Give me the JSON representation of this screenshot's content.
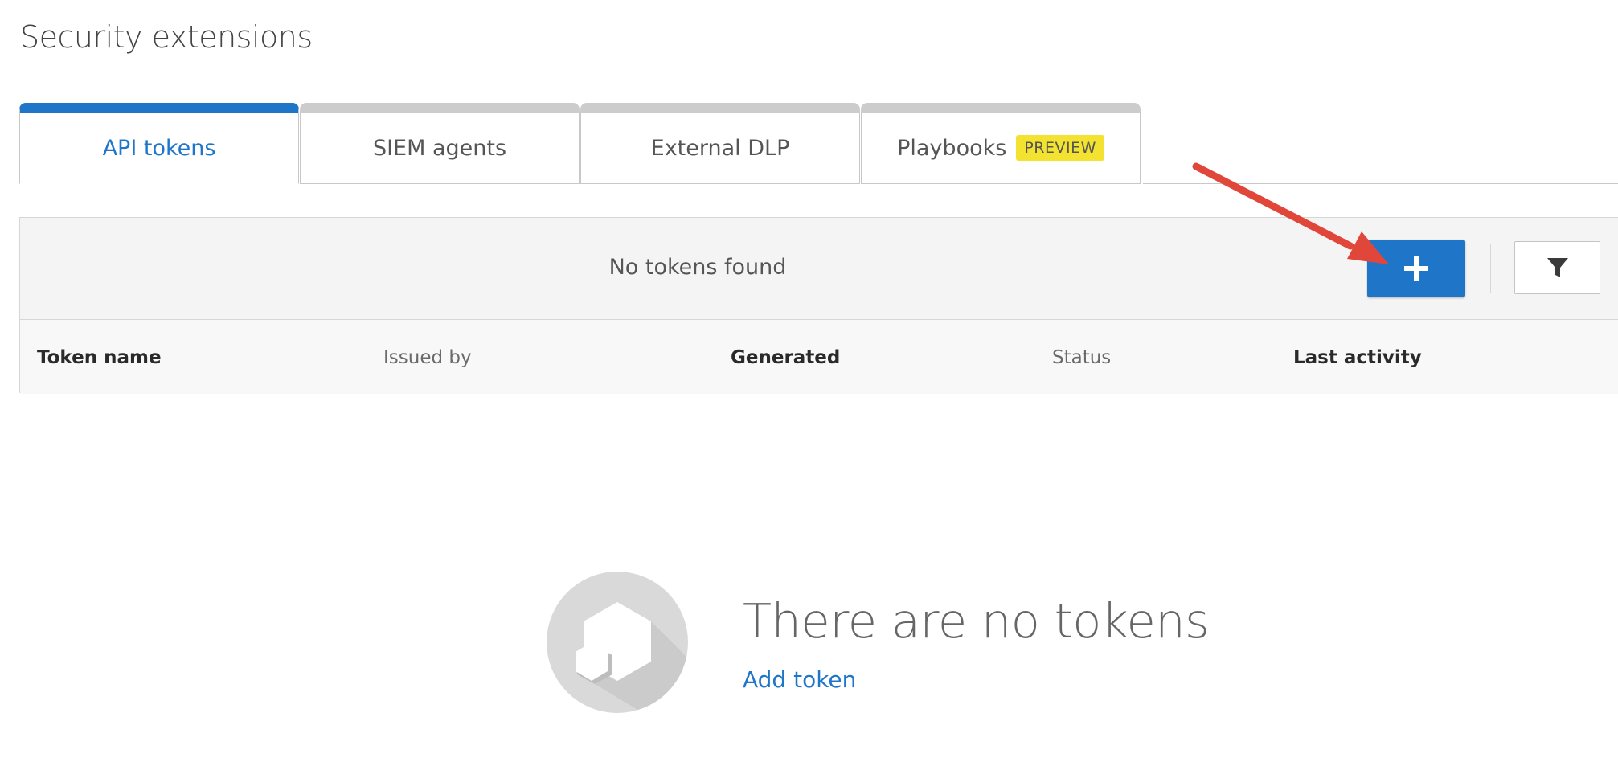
{
  "page": {
    "title": "Security extensions"
  },
  "tabs": [
    {
      "label": "API tokens",
      "active": true
    },
    {
      "label": "SIEM agents",
      "active": false
    },
    {
      "label": "External DLP",
      "active": false
    },
    {
      "label": "Playbooks",
      "active": false,
      "badge": "PREVIEW"
    }
  ],
  "toolbar": {
    "status_text": "No tokens found",
    "add_button_icon": "plus-icon",
    "filter_button_icon": "filter-icon"
  },
  "table": {
    "columns": [
      "Token name",
      "Issued by",
      "Generated",
      "Status",
      "Last activity"
    ]
  },
  "empty_state": {
    "title": "There are no tokens",
    "link": "Add token",
    "icon": "hexagons-icon"
  },
  "annotation": {
    "icon": "red-arrow-icon",
    "color": "#e0463a"
  },
  "colors": {
    "accent": "#1f76c9",
    "badge": "#f3e330"
  }
}
